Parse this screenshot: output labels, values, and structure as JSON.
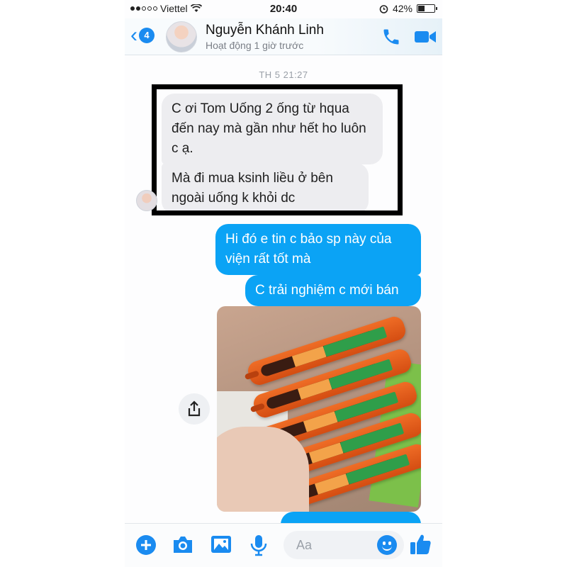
{
  "status_bar": {
    "carrier": "Viettel",
    "time": "20:40",
    "battery": "42%",
    "battery_level": 0.42,
    "signal_bars_filled": 2,
    "signal_bars_total": 5
  },
  "header": {
    "back_count": "4",
    "contact_name": "Nguyễn Khánh Linh",
    "contact_status": "Hoạt động 1 giờ trước",
    "icons": [
      "chevron-left-icon",
      "phone-icon",
      "video-camera-icon"
    ]
  },
  "conversation": {
    "timestamp": "TH 5 21:27",
    "messages": [
      {
        "side": "incoming",
        "text": "C ơi Tom Uống 2 ống từ hqua đến nay mà gần như hết ho luôn c ạ."
      },
      {
        "side": "incoming",
        "text": "Mà đi mua ksinh liều ở bên ngoài uống k khỏi dc"
      },
      {
        "side": "outgoing",
        "text": "Hi đó e tin c bảo sp này của viện rất tốt mà"
      },
      {
        "side": "outgoing",
        "text": "C trải nghiệm c mới bán"
      }
    ],
    "photo_icon": "share-icon"
  },
  "composer": {
    "placeholder": "Aa",
    "icons": [
      "plus-icon",
      "camera-icon",
      "image-icon",
      "microphone-icon",
      "emoji-icon",
      "thumbs-up-icon"
    ]
  },
  "colors": {
    "accent": "#1a8bf0",
    "outgoing_bubble": "#0ba3f5",
    "incoming_bubble": "#ededf0",
    "highlight_border": "#000000"
  }
}
